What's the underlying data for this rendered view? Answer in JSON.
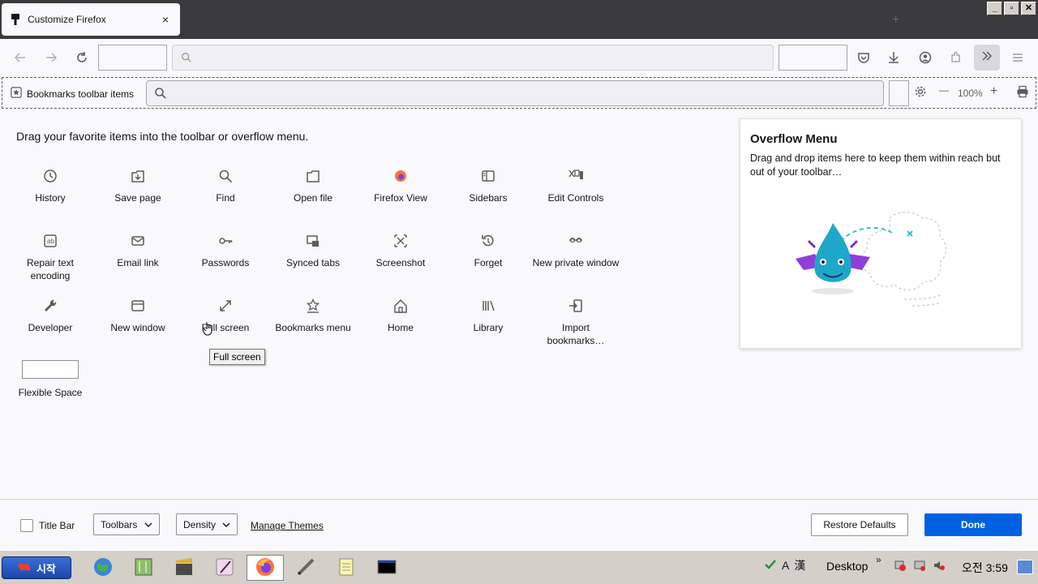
{
  "tab": {
    "title": "Customize Firefox",
    "close_glyph": "×"
  },
  "window_controls": {
    "minimize": "_",
    "maximize": "▫",
    "close": "✕"
  },
  "bookmarks_toolbar": {
    "item_label": "Bookmarks toolbar items",
    "zoom_out": "—",
    "zoom_level": "100%",
    "zoom_in": "+"
  },
  "main": {
    "instructions": "Drag your favorite items into the toolbar or overflow menu.",
    "palette": [
      {
        "label": "History",
        "icon": "clock-icon"
      },
      {
        "label": "Save page",
        "icon": "save-page-icon"
      },
      {
        "label": "Find",
        "icon": "search-icon"
      },
      {
        "label": "Open file",
        "icon": "open-file-icon"
      },
      {
        "label": "Firefox View",
        "icon": "firefox-view-icon"
      },
      {
        "label": "Sidebars",
        "icon": "sidebar-icon"
      },
      {
        "label": "Edit Controls",
        "icon": "edit-controls-icon"
      },
      {
        "label": "Repair text encoding",
        "icon": "text-encoding-icon"
      },
      {
        "label": "Email link",
        "icon": "email-icon"
      },
      {
        "label": "Passwords",
        "icon": "key-icon"
      },
      {
        "label": "Synced tabs",
        "icon": "synced-tabs-icon"
      },
      {
        "label": "Screenshot",
        "icon": "screenshot-icon"
      },
      {
        "label": "Forget",
        "icon": "forget-icon"
      },
      {
        "label": "New private window",
        "icon": "private-mask-icon"
      },
      {
        "label": "Developer",
        "icon": "wrench-icon"
      },
      {
        "label": "New window",
        "icon": "new-window-icon"
      },
      {
        "label": "Full screen",
        "icon": "fullscreen-icon"
      },
      {
        "label": "Bookmarks menu",
        "icon": "bookmarks-menu-icon"
      },
      {
        "label": "Home",
        "icon": "home-icon"
      },
      {
        "label": "Library",
        "icon": "library-icon"
      },
      {
        "label": "Import bookmarks…",
        "icon": "import-icon"
      }
    ],
    "flexible_space": "Flexible Space",
    "tooltip": "Full screen"
  },
  "overflow": {
    "title": "Overflow Menu",
    "description": "Drag and drop items here to keep them within reach but out of your toolbar…"
  },
  "footer": {
    "title_bar": "Title Bar",
    "toolbars": "Toolbars",
    "density": "Density",
    "manage_themes": "Manage Themes",
    "restore_defaults": "Restore Defaults",
    "done": "Done"
  },
  "taskbar": {
    "start": "시작",
    "ime_a": "A",
    "ime_han": "漢",
    "desktop": "Desktop",
    "chevron": "»",
    "clock": "오전 3:59"
  },
  "colors": {
    "accent": "#0061e0",
    "tabstrip": "#3b3b3d",
    "taskbar": "#d4d0c8"
  }
}
